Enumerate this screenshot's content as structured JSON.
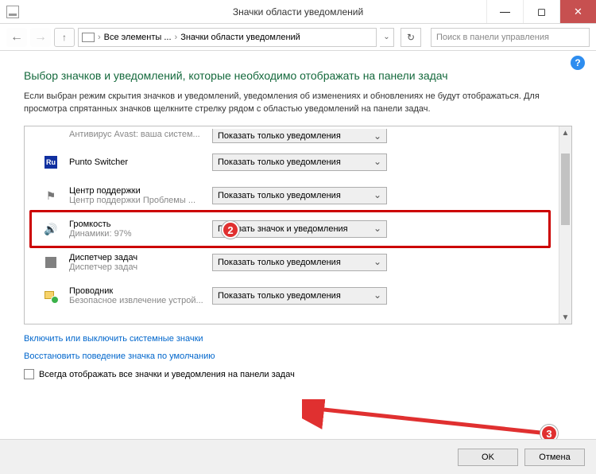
{
  "window": {
    "title": "Значки области уведомлений"
  },
  "nav": {
    "crumb1": "Все элементы ...",
    "crumb2": "Значки области уведомлений",
    "search_placeholder": "Поиск в панели управления"
  },
  "heading": "Выбор значков и уведомлений, которые необходимо отображать на панели задач",
  "description": "Если выбран режим скрытия значков и уведомлений, уведомления об изменениях и обновлениях не будут отображаться. Для просмотра спрятанных значков щелкните стрелку рядом с областью уведомлений на панели задач.",
  "dropdown_options": {
    "show_icon_and_notif": "Показать значок и уведомления",
    "show_notif_only": "Показать только уведомления"
  },
  "rows": [
    {
      "icon": "avast",
      "label": "",
      "sub": "Антивирус Avast: ваша систем...",
      "value": "show_notif_only",
      "top": true
    },
    {
      "icon": "ru",
      "label": "Punto Switcher",
      "sub": "",
      "value": "show_notif_only"
    },
    {
      "icon": "flag",
      "label": "Центр поддержки",
      "sub": "Центр поддержки   Проблемы ...",
      "value": "show_notif_only"
    },
    {
      "icon": "vol",
      "label": "Громкость",
      "sub": "Динамики: 97%",
      "value": "show_icon_and_notif",
      "highlight": true
    },
    {
      "icon": "tm",
      "label": "Диспетчер задач",
      "sub": "Диспетчер задач",
      "value": "show_notif_only"
    },
    {
      "icon": "ex",
      "label": "Проводник",
      "sub": "Безопасное извлечение устрой...",
      "value": "show_notif_only"
    }
  ],
  "links": {
    "toggle_system": "Включить или выключить системные значки",
    "restore_default": "Восстановить поведение значка по умолчанию"
  },
  "checkbox_label": "Всегда отображать все значки и уведомления на панели задач",
  "buttons": {
    "ok": "OK",
    "cancel": "Отмена"
  },
  "badges": {
    "b2": "2",
    "b3": "3"
  }
}
